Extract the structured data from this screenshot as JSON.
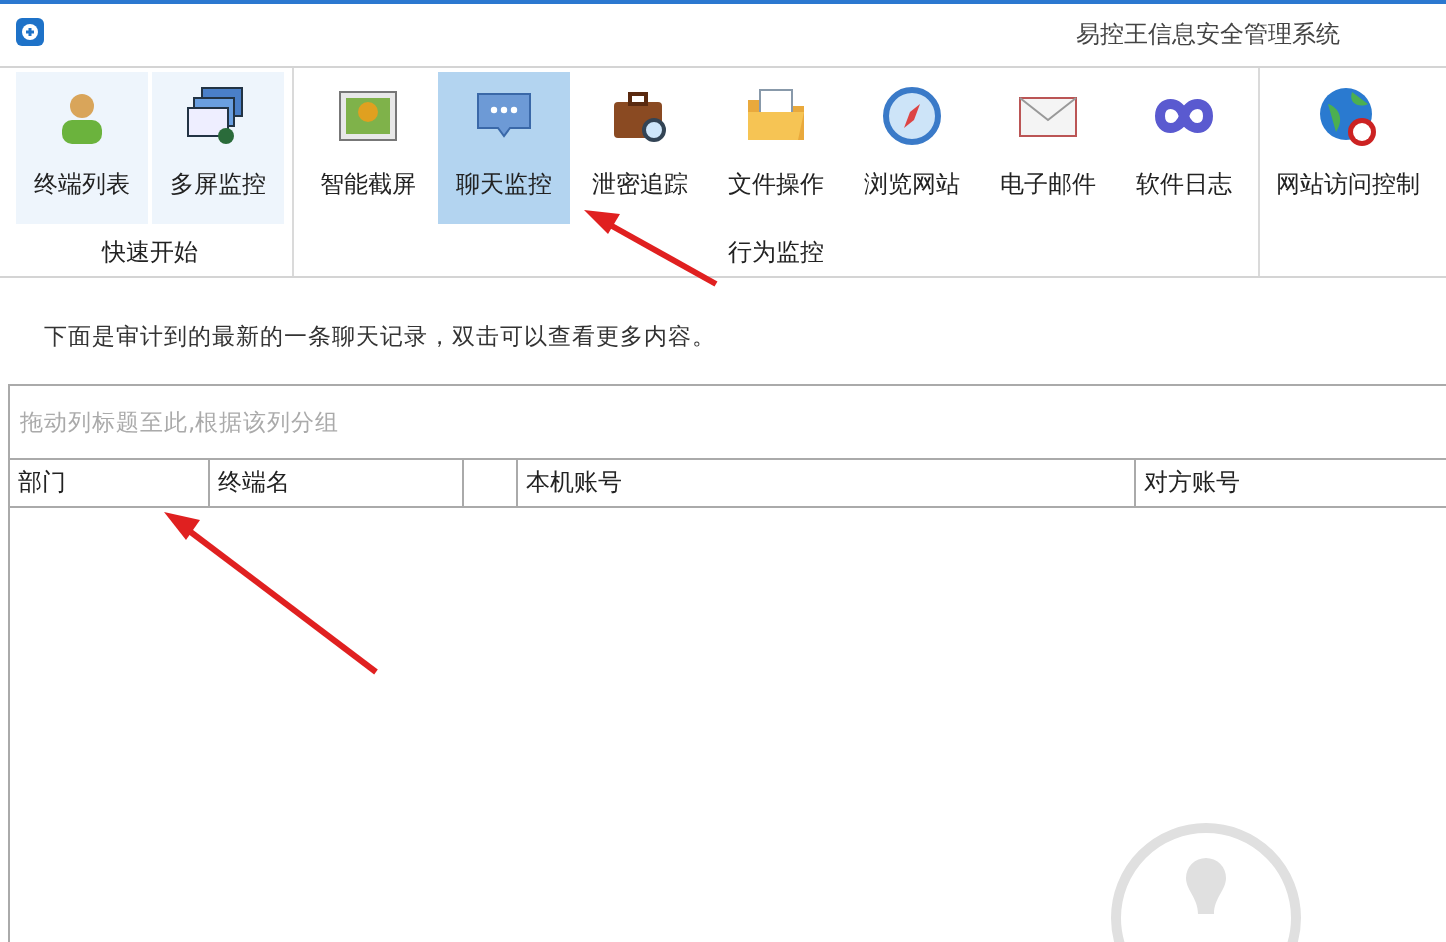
{
  "window": {
    "title": "易控王信息安全管理系统"
  },
  "ribbon": {
    "groups": [
      {
        "label": "快速开始",
        "kind": "quick",
        "buttons": [
          {
            "label": "终端列表",
            "selected": false
          },
          {
            "label": "多屏监控",
            "selected": false
          }
        ]
      },
      {
        "label": "行为监控",
        "kind": "normal",
        "buttons": [
          {
            "label": "智能截屏",
            "selected": false
          },
          {
            "label": "聊天监控",
            "selected": true
          },
          {
            "label": "泄密追踪",
            "selected": false
          },
          {
            "label": "文件操作",
            "selected": false
          },
          {
            "label": "浏览网站",
            "selected": false
          },
          {
            "label": "电子邮件",
            "selected": false
          },
          {
            "label": "软件日志",
            "selected": false
          }
        ]
      },
      {
        "kind": "normal",
        "buttons": [
          {
            "label": "网站访问控制",
            "selected": false
          }
        ]
      }
    ]
  },
  "hint": "下面是审计到的最新的一条聊天记录，双击可以查看更多内容。",
  "grid": {
    "group_panel": "拖动列标题至此,根据该列分组",
    "columns": [
      "部门",
      "终端名",
      "",
      "本机账号",
      "对方账号"
    ]
  }
}
